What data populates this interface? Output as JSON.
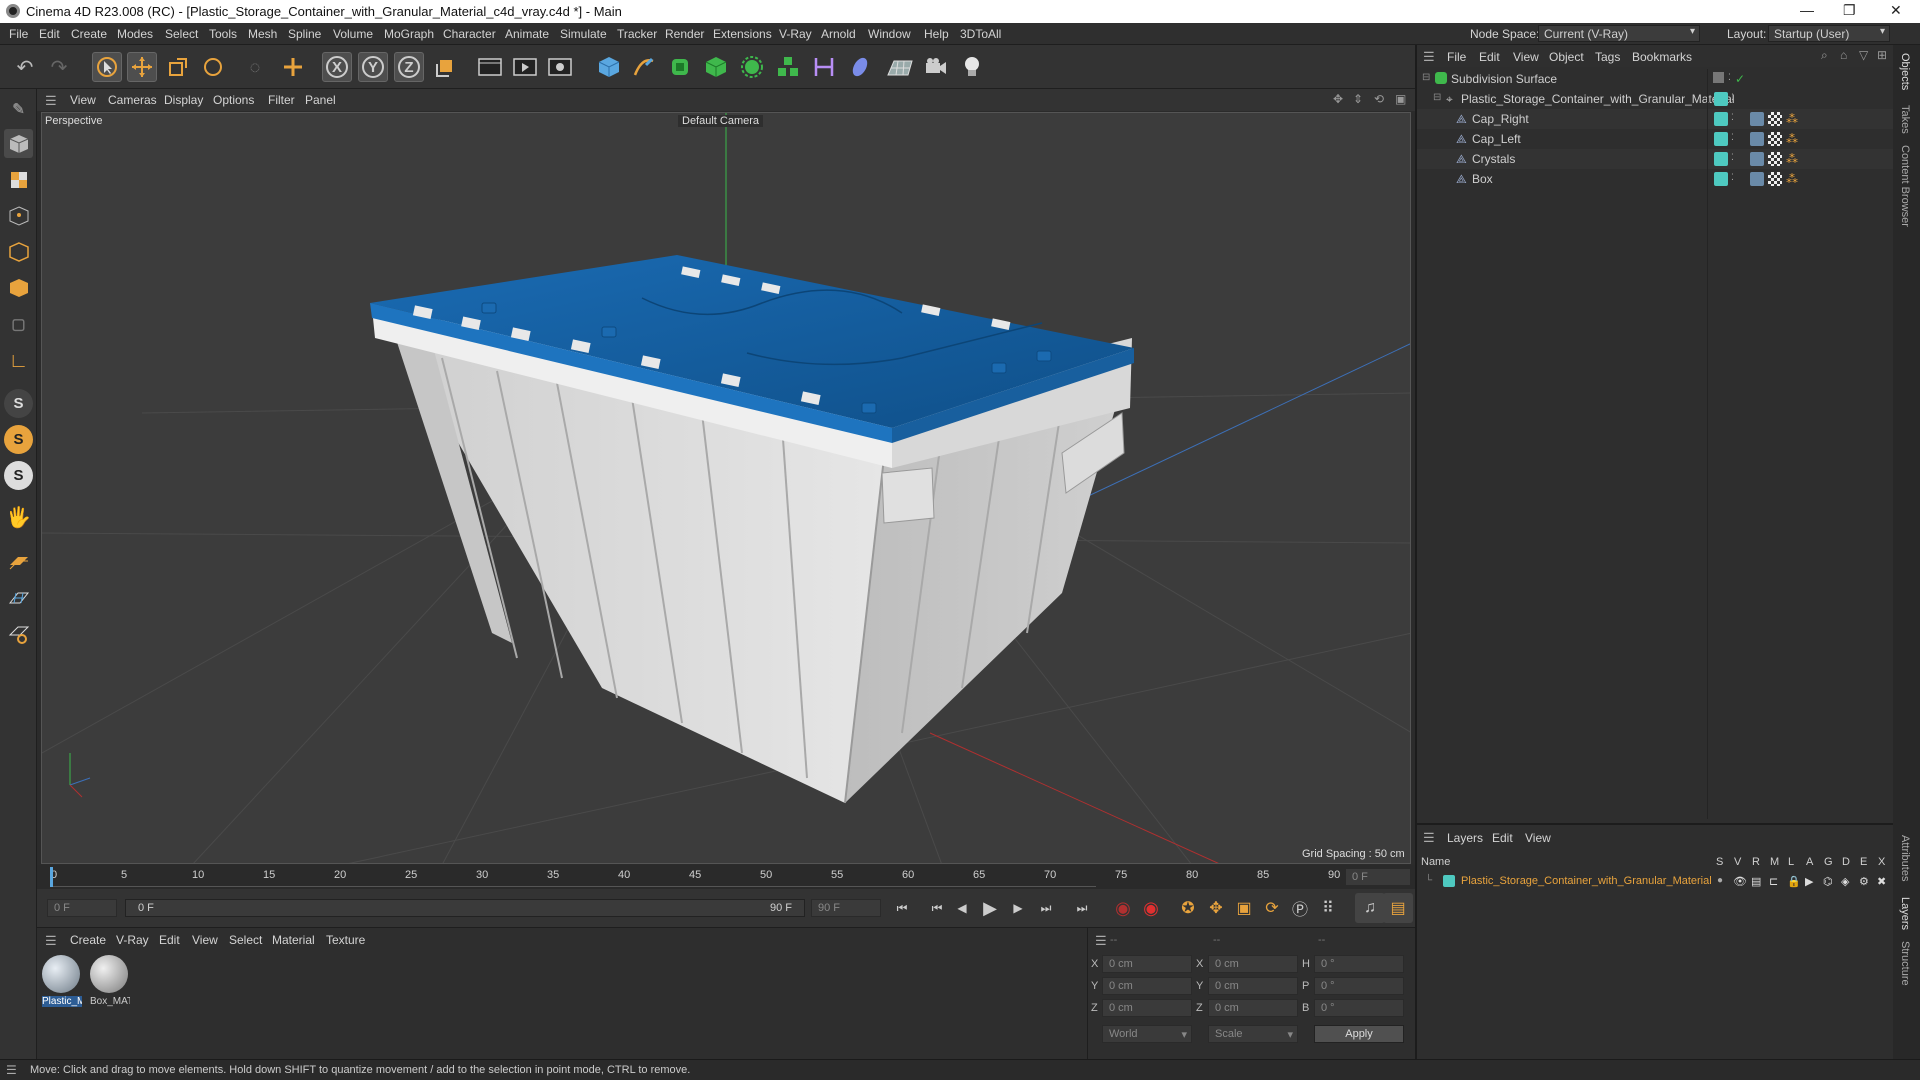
{
  "window": {
    "title": "Cinema 4D R23.008 (RC) - [Plastic_Storage_Container_with_Granular_Material_c4d_vray.c4d *] - Main"
  },
  "menu": [
    "File",
    "Edit",
    "Create",
    "Modes",
    "Select",
    "Tools",
    "Mesh",
    "Spline",
    "Volume",
    "MoGraph",
    "Character",
    "Animate",
    "Simulate",
    "Tracker",
    "Render",
    "Extensions",
    "V-Ray",
    "Arnold",
    "Window",
    "Help",
    "3DToAll"
  ],
  "node_space": {
    "label": "Node Space:",
    "value": "Current (V-Ray)"
  },
  "layout": {
    "label": "Layout:",
    "value": "Startup (User)"
  },
  "viewport": {
    "menu": [
      "View",
      "Cameras",
      "Display",
      "Options",
      "Filter",
      "Panel"
    ],
    "name": "Perspective",
    "camera": "Default Camera",
    "grid_spacing": "Grid Spacing : 50 cm"
  },
  "timeline": {
    "ticks": [
      "0",
      "5",
      "10",
      "15",
      "20",
      "25",
      "30",
      "35",
      "40",
      "45",
      "50",
      "55",
      "60",
      "65",
      "70",
      "75",
      "80",
      "85",
      "90"
    ],
    "current_frame": "0 F"
  },
  "transport": {
    "start": "0 F",
    "range_start": "0 F",
    "range_end": "90 F",
    "end": "90 F"
  },
  "materials": {
    "menu": [
      "Create",
      "V-Ray",
      "Edit",
      "View",
      "Select",
      "Material",
      "Texture"
    ],
    "items": [
      "Plastic_M",
      "Box_MAT"
    ]
  },
  "coords": {
    "headers": [
      "--",
      "--",
      "--"
    ],
    "rows": [
      {
        "a": "X",
        "av": "0 cm",
        "b": "X",
        "bv": "0 cm",
        "c": "H",
        "cv": "0 °"
      },
      {
        "a": "Y",
        "av": "0 cm",
        "b": "Y",
        "bv": "0 cm",
        "c": "P",
        "cv": "0 °"
      },
      {
        "a": "Z",
        "av": "0 cm",
        "b": "Z",
        "bv": "0 cm",
        "c": "B",
        "cv": "0 °"
      }
    ],
    "mode1": "World",
    "mode2": "Scale",
    "apply": "Apply"
  },
  "object_manager": {
    "menu": [
      "File",
      "Edit",
      "View",
      "Object",
      "Tags",
      "Bookmarks"
    ],
    "objects": [
      {
        "name": "Subdivision Surface",
        "depth": 0
      },
      {
        "name": "Plastic_Storage_Container_with_Granular_Material",
        "depth": 1
      },
      {
        "name": "Cap_Right",
        "depth": 2
      },
      {
        "name": "Cap_Left",
        "depth": 2
      },
      {
        "name": "Crystals",
        "depth": 2
      },
      {
        "name": "Box",
        "depth": 2
      }
    ]
  },
  "layer_manager": {
    "menu": [
      "Layers",
      "Edit",
      "View"
    ],
    "name_header": "Name",
    "columns": [
      "S",
      "V",
      "R",
      "M",
      "L",
      "A",
      "G",
      "D",
      "E",
      "X"
    ],
    "layer": "Plastic_Storage_Container_with_Granular_Material",
    "layer_color": "#4ec9c0"
  },
  "right_tabs": [
    "Objects",
    "Takes",
    "Content Browser",
    "Attributes",
    "Layers",
    "Structure"
  ],
  "status": "Move: Click and drag to move elements. Hold down SHIFT to quantize movement / add to the selection in point mode, CTRL to remove.",
  "colors": {
    "accent": "#e8a33d",
    "lid": "#1565a8",
    "box": "#d8d8d8",
    "object_tag": "#4ec9c0"
  }
}
